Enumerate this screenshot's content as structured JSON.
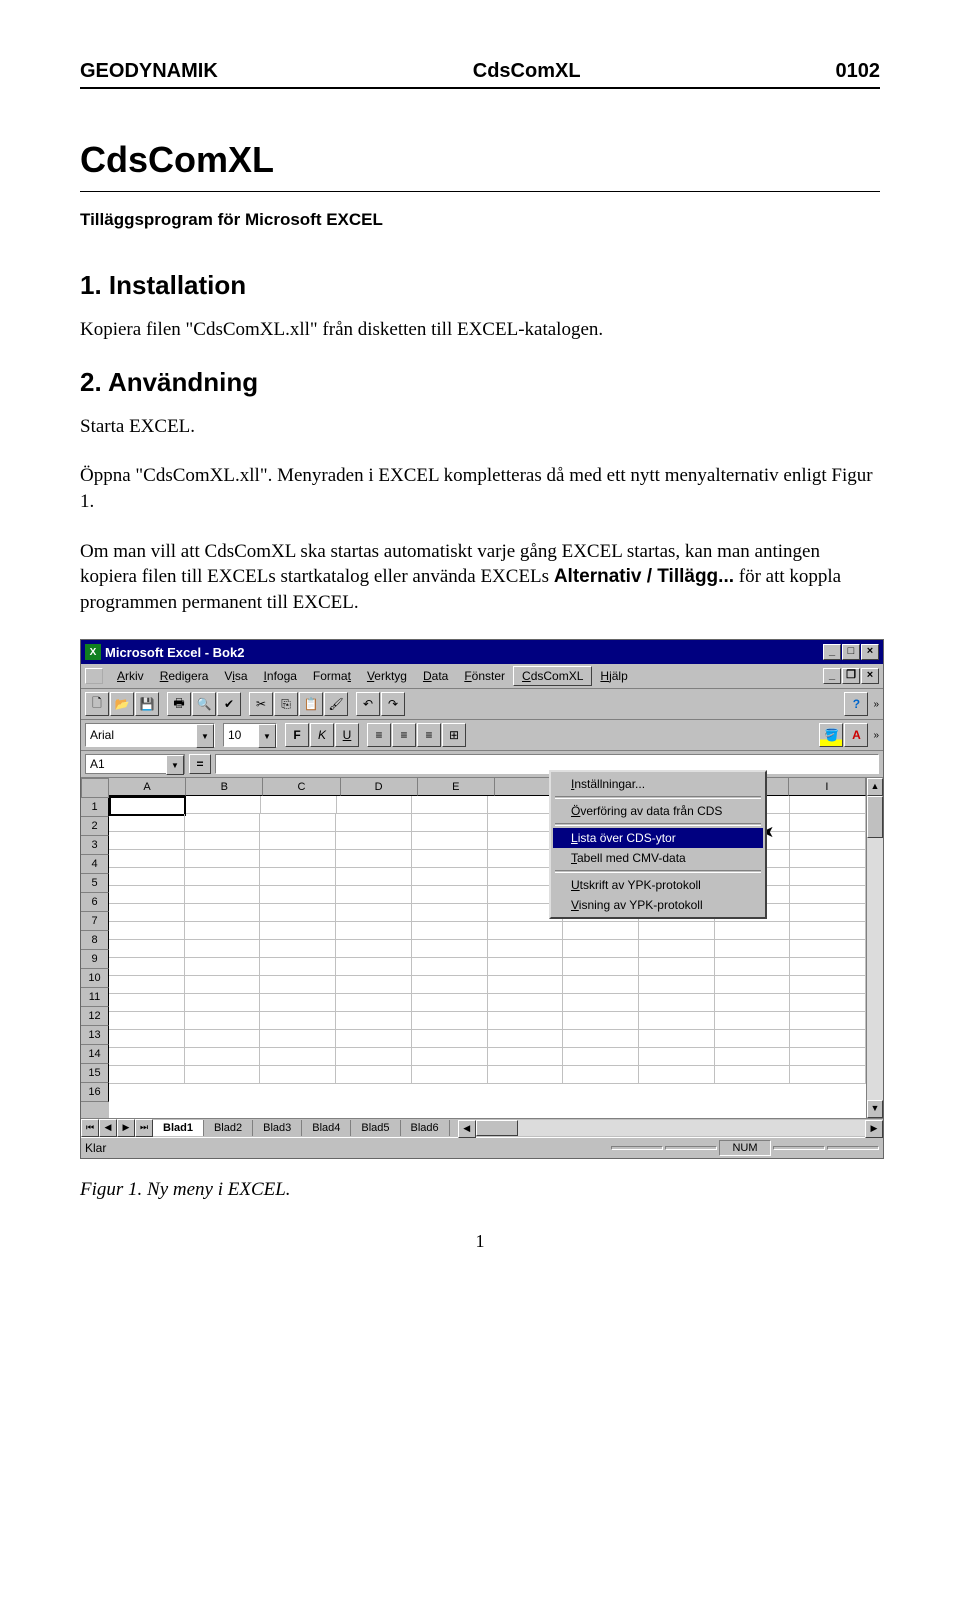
{
  "header": {
    "left": "GEODYNAMIK",
    "center": "CdsComXL",
    "right": "0102"
  },
  "title": "CdsComXL",
  "subtitle": "Tilläggsprogram för Microsoft EXCEL",
  "section1": {
    "heading": "1. Installation",
    "p1": "Kopiera filen \"CdsComXL.xll\" från disketten till EXCEL-katalogen."
  },
  "section2": {
    "heading": "2. Användning",
    "p1": "Starta EXCEL.",
    "p2": "Öppna \"CdsComXL.xll\". Menyraden i EXCEL kompletteras då med ett nytt menyalternativ enligt Figur 1.",
    "p3a": "Om man vill att CdsComXL ska startas automatiskt varje gång EXCEL startas, kan man antingen kopiera filen till EXCELs startkatalog eller använda EXCELs ",
    "p3bold": "Alternativ / Tillägg...",
    "p3b": " för att koppla programmen permanent till EXCEL."
  },
  "excel": {
    "titlebar": "Microsoft Excel - Bok2",
    "menus": [
      "Arkiv",
      "Redigera",
      "Visa",
      "Infoga",
      "Format",
      "Verktyg",
      "Data",
      "Fönster",
      "CdsComXL",
      "Hjälp"
    ],
    "font_name": "Arial",
    "font_size": "10",
    "name_box": "A1",
    "columns": [
      "A",
      "B",
      "C",
      "D",
      "E",
      "I"
    ],
    "rows": [
      "1",
      "2",
      "3",
      "4",
      "5",
      "6",
      "7",
      "8",
      "9",
      "10",
      "11",
      "12",
      "13",
      "14",
      "15",
      "16"
    ],
    "dropdown": {
      "items": [
        "Inställningar...",
        "Överföring av data från CDS",
        "Lista över CDS-ytor",
        "Tabell med CMV-data",
        "Utskrift av YPK-protokoll",
        "Visning av YPK-protokoll"
      ],
      "highlighted_index": 2
    },
    "sheet_tabs": [
      "Blad1",
      "Blad2",
      "Blad3",
      "Blad4",
      "Blad5",
      "Blad6"
    ],
    "status": "Klar",
    "status_num": "NUM",
    "format_buttons": {
      "bold": "F",
      "italic": "K",
      "underline": "U"
    }
  },
  "figure_caption": "Figur 1. Ny meny i EXCEL.",
  "page_number": "1"
}
